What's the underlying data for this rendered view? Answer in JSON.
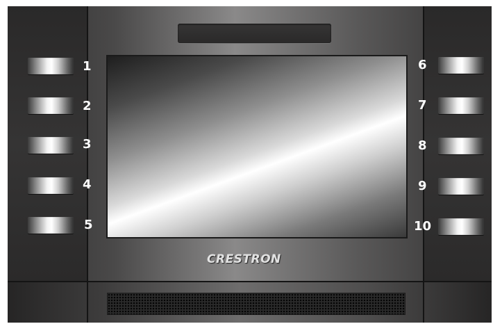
{
  "panel": {
    "brand": "CRESTRON"
  },
  "left_buttons": [
    {
      "number": "1"
    },
    {
      "number": "2"
    },
    {
      "number": "3"
    },
    {
      "number": "4"
    },
    {
      "number": "5"
    }
  ],
  "right_buttons": [
    {
      "number": "6"
    },
    {
      "number": "7"
    },
    {
      "number": "8"
    },
    {
      "number": "9"
    },
    {
      "number": "10"
    }
  ],
  "colors": {
    "frame": "#3c3b3b",
    "button_highlight": "#ffffff",
    "label_text": "#ffffff"
  }
}
